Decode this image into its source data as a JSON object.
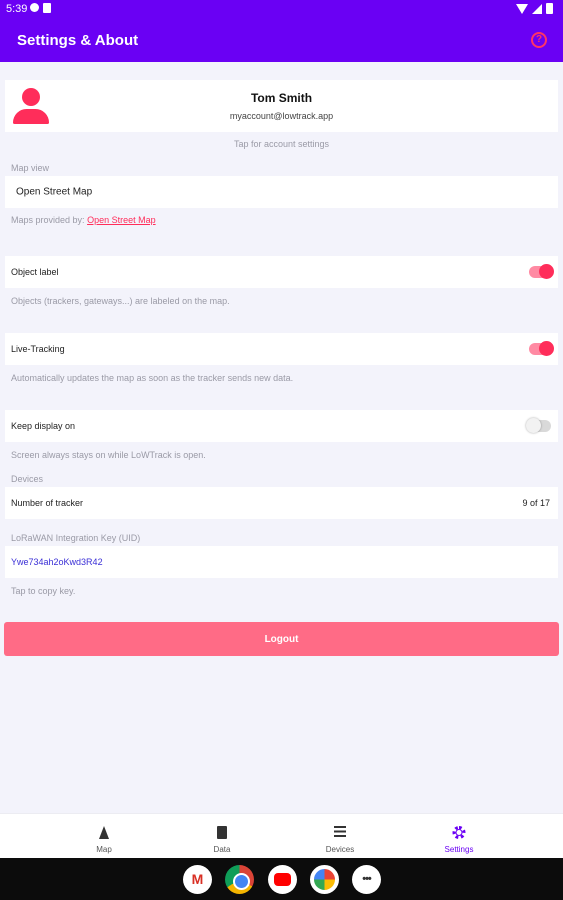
{
  "status_bar": {
    "time": "5:39"
  },
  "app_bar": {
    "title": "Settings & About",
    "help_icon": "help-circle-icon"
  },
  "account": {
    "name": "Tom Smith",
    "email": "myaccount@lowtrack.app",
    "hint": "Tap for account settings"
  },
  "map_view": {
    "section_label": "Map view",
    "value": "Open Street Map",
    "provided_by": "Maps provided by:",
    "provider_link": "Open Street Map"
  },
  "object_label": {
    "label": "Object label",
    "on": true,
    "description": "Objects (trackers, gateways...) are labeled on the map."
  },
  "live_tracking": {
    "label": "Live-Tracking",
    "on": true,
    "description": "Automatically updates the map as soon as the tracker sends new data."
  },
  "keep_display": {
    "label": "Keep display on",
    "on": false,
    "description": "Screen always stays on while LoWTrack is open."
  },
  "devices": {
    "section_label": "Devices",
    "tracker_label": "Number of tracker",
    "tracker_value": "9 of 17"
  },
  "integration": {
    "section_label": "LoRaWAN Integration Key (UID)",
    "key": "Ywe734ah2oKwd3R42",
    "hint": "Tap to copy key."
  },
  "logout_label": "Logout",
  "bottom_nav": {
    "items": [
      {
        "label": "Map",
        "icon": "navigation-arrow-icon"
      },
      {
        "label": "Data",
        "icon": "document-icon"
      },
      {
        "label": "Devices",
        "icon": "list-icon"
      },
      {
        "label": "Settings",
        "icon": "gear-icon",
        "active": true
      }
    ]
  },
  "dock": {
    "apps": [
      "gmail-icon",
      "chrome-icon",
      "youtube-icon",
      "photos-icon",
      "app-launcher-icon"
    ]
  },
  "colors": {
    "primary": "#6a00f4",
    "accent": "#ff2d5a",
    "logout_button": "#ff6b86",
    "background": "#f3f3fb"
  }
}
